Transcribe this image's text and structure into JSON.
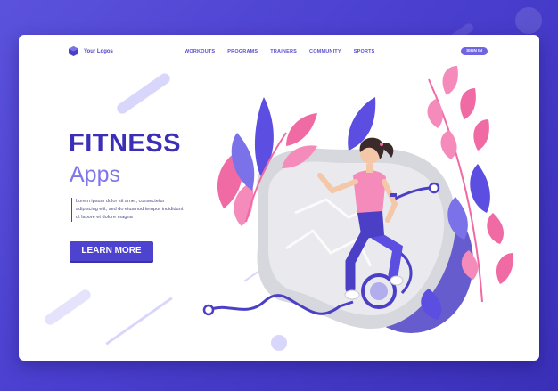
{
  "brand": {
    "name": "Your Logos",
    "icon": "cube-icon"
  },
  "nav": {
    "links": [
      "WORKOUTS",
      "PROGRAMS",
      "TRAINERS",
      "COMMUNITY",
      "SPORTS"
    ],
    "signin_label": "SIGN IN"
  },
  "hero": {
    "title": "FITNESS",
    "subtitle": "Apps",
    "description": "Lorem ipsum dolor sit amet, consectetur adipiscing elit, sed do eiusmod tempor incididunt ut labore et dolore magna",
    "cta_label": "LEARN MORE"
  },
  "colors": {
    "background": "#4a3fcf",
    "primary": "#4d43cf",
    "title": "#3b2fb8",
    "subtitle": "#7f76e8",
    "pink": "#f06aa4",
    "leaf_blue": "#5b4ee0"
  },
  "illustration": {
    "name": "running-girl-illustration"
  }
}
